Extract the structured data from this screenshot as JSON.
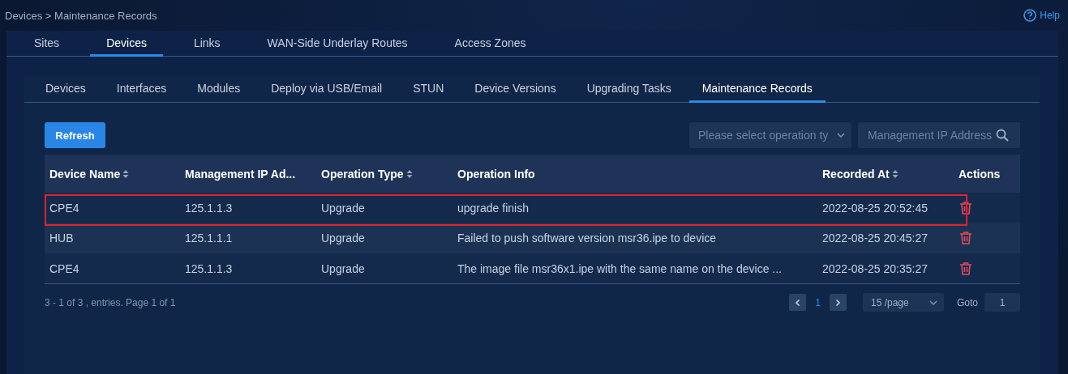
{
  "breadcrumb": "Devices > Maintenance Records",
  "help": "Help",
  "tabs": [
    {
      "label": "Sites",
      "selected": false
    },
    {
      "label": "Devices",
      "selected": true
    },
    {
      "label": "Links",
      "selected": false
    },
    {
      "label": "WAN-Side Underlay Routes",
      "selected": false
    },
    {
      "label": "Access Zones",
      "selected": false
    }
  ],
  "subtabs": [
    {
      "label": "Devices",
      "selected": false
    },
    {
      "label": "Interfaces",
      "selected": false
    },
    {
      "label": "Modules",
      "selected": false
    },
    {
      "label": "Deploy via USB/Email",
      "selected": false
    },
    {
      "label": "STUN",
      "selected": false
    },
    {
      "label": "Device Versions",
      "selected": false
    },
    {
      "label": "Upgrading Tasks",
      "selected": false
    },
    {
      "label": "Maintenance Records",
      "selected": true
    }
  ],
  "toolbar": {
    "refresh": "Refresh",
    "operation_select": {
      "placeholder": "Please select operation ty"
    },
    "ip_search": {
      "placeholder": "Management IP Address"
    }
  },
  "table": {
    "columns": [
      {
        "label": "Device Name",
        "sortable": true
      },
      {
        "label": "Management IP Ad...",
        "sortable": false
      },
      {
        "label": "Operation Type",
        "sortable": true
      },
      {
        "label": "Operation Info",
        "sortable": false
      },
      {
        "label": "Recorded At",
        "sortable": true
      },
      {
        "label": "Actions",
        "sortable": false
      }
    ],
    "rows": [
      {
        "cells": [
          "CPE4",
          "125.1.1.3",
          "Upgrade",
          "upgrade finish",
          "2022-08-25 20:52:45"
        ],
        "highlighted": true
      },
      {
        "cells": [
          "HUB",
          "125.1.1.1",
          "Upgrade",
          "Failed to push software version msr36.ipe to device",
          "2022-08-25 20:45:27"
        ],
        "highlighted": false
      },
      {
        "cells": [
          "CPE4",
          "125.1.1.3",
          "Upgrade",
          "The image file msr36x1.ipe with the same name on the device ...",
          "2022-08-25 20:35:27"
        ],
        "highlighted": false
      }
    ]
  },
  "pagination": {
    "summary": "3 - 1 of 3 , entries. Page 1 of 1",
    "current_page": "1",
    "page_size": "15 /page",
    "goto_label": "Goto",
    "goto_value": "1"
  }
}
